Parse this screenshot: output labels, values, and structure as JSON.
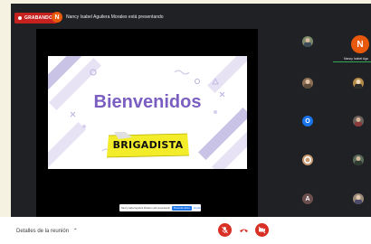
{
  "recording": {
    "label": "GRABANDO"
  },
  "presenter": {
    "initial": "N",
    "text": "Nancy Isabel Aguilera Morales está presentando"
  },
  "slide": {
    "title": "Bienvenidos",
    "tape_text": "BRIGADISTA"
  },
  "share_bar": {
    "text": "Nancy Isabel Aguilera Morales está presentando",
    "primary": "Presentar ahora",
    "secondary": "Ocultar"
  },
  "participants": {
    "featured": {
      "initial": "N",
      "name": "Nancy Isabel Agu"
    },
    "initials": [
      "O",
      "A"
    ]
  },
  "bottom": {
    "meeting_details": "Detalles de la reunión"
  },
  "colors": {
    "recording": "#c5221f",
    "presenter": "#e8590c",
    "end_call": "#d93025",
    "accent": "#1a73e8"
  }
}
